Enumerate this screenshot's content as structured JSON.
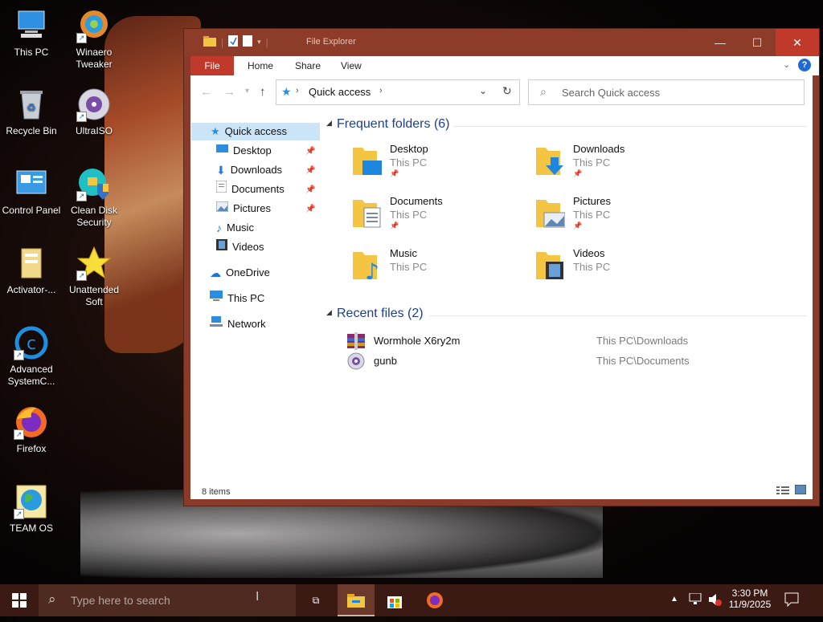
{
  "desktop": {
    "icons": [
      {
        "label": "This PC",
        "icon": "computer-icon"
      },
      {
        "label": "Winaero Tweaker",
        "icon": "winaero-icon"
      },
      {
        "label": "Recycle Bin",
        "icon": "recycle-bin-icon"
      },
      {
        "label": "UltraISO",
        "icon": "disc-icon"
      },
      {
        "label": "Control Panel",
        "icon": "control-panel-icon"
      },
      {
        "label": "Clean Disk Security",
        "icon": "shield-icon"
      },
      {
        "label": "Activator-...",
        "icon": "folder-icon"
      },
      {
        "label": "Unattended Soft",
        "icon": "star-icon"
      },
      {
        "label": "Advanced SystemC...",
        "icon": "advanced-systemcare-icon"
      },
      {
        "label": "Firefox",
        "icon": "firefox-icon"
      },
      {
        "label": "TEAM OS",
        "icon": "globe-icon"
      }
    ]
  },
  "explorer": {
    "title": "File Explorer",
    "tabs": {
      "file": "File",
      "home": "Home",
      "share": "Share",
      "view": "View"
    },
    "address": "Quick access",
    "search_placeholder": "Search Quick access",
    "nav": {
      "quick_access": "Quick access",
      "desktop": "Desktop",
      "downloads": "Downloads",
      "documents": "Documents",
      "pictures": "Pictures",
      "music": "Music",
      "videos": "Videos",
      "onedrive": "OneDrive",
      "this_pc": "This PC",
      "network": "Network"
    },
    "frequent_title": "Frequent folders (6)",
    "folders": [
      {
        "name": "Desktop",
        "location": "This PC",
        "pinned": true
      },
      {
        "name": "Downloads",
        "location": "This PC",
        "pinned": true
      },
      {
        "name": "Documents",
        "location": "This PC",
        "pinned": true
      },
      {
        "name": "Pictures",
        "location": "This PC",
        "pinned": true
      },
      {
        "name": "Music",
        "location": "This PC",
        "pinned": false
      },
      {
        "name": "Videos",
        "location": "This PC",
        "pinned": false
      }
    ],
    "recent_title": "Recent files (2)",
    "recent": [
      {
        "name": "Wormhole X6ry2m",
        "path": "This PC\\Downloads"
      },
      {
        "name": "gunb",
        "path": "This PC\\Documents"
      }
    ],
    "status": "8 items"
  },
  "taskbar": {
    "search_placeholder": "Type here to search",
    "time": "3:30 PM",
    "date": "11/9/2025"
  },
  "colors": {
    "accent": "#c0392b",
    "titlebar": "#8e3c2a",
    "link": "#1e3f8a",
    "selection": "#cce4f7"
  }
}
